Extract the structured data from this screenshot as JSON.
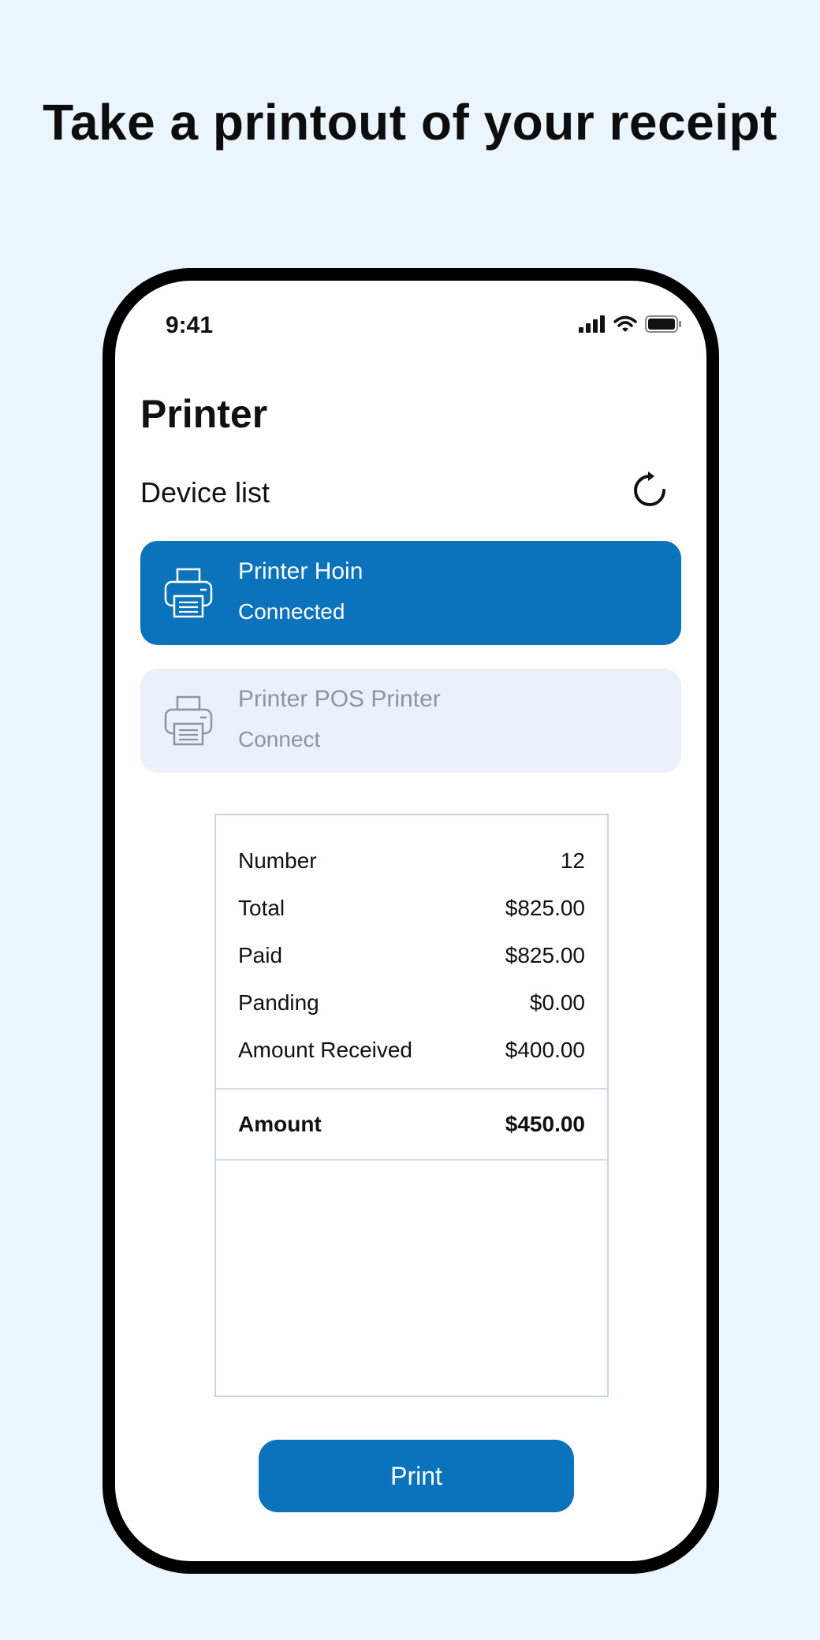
{
  "headline": "Take a printout of your receipt",
  "status_bar": {
    "time": "9:41",
    "icons": [
      "signal-icon",
      "wifi-icon",
      "battery-icon"
    ]
  },
  "screen": {
    "title": "Printer",
    "device_list_label": "Device list",
    "refresh_icon": "refresh-icon"
  },
  "devices": [
    {
      "name": "Printer Hoin",
      "status": "Connected",
      "state": "connected",
      "icon": "printer-icon"
    },
    {
      "name": "Printer POS Printer",
      "status": "Connect",
      "state": "available",
      "icon": "printer-icon"
    }
  ],
  "receipt": {
    "rows": [
      {
        "label": "Number",
        "value": "12"
      },
      {
        "label": "Total",
        "value": "$825.00"
      },
      {
        "label": "Paid",
        "value": "$825.00"
      },
      {
        "label": "Panding",
        "value": "$0.00"
      },
      {
        "label": "Amount Received",
        "value": "$400.00"
      }
    ],
    "total": {
      "label": "Amount",
      "value": "$450.00"
    }
  },
  "print_button": {
    "label": "Print"
  },
  "colors": {
    "background": "#ebf5fe",
    "accent": "#0b73bb",
    "inactive_card": "#eaf1fa",
    "inactive_text": "#8a96a4"
  }
}
